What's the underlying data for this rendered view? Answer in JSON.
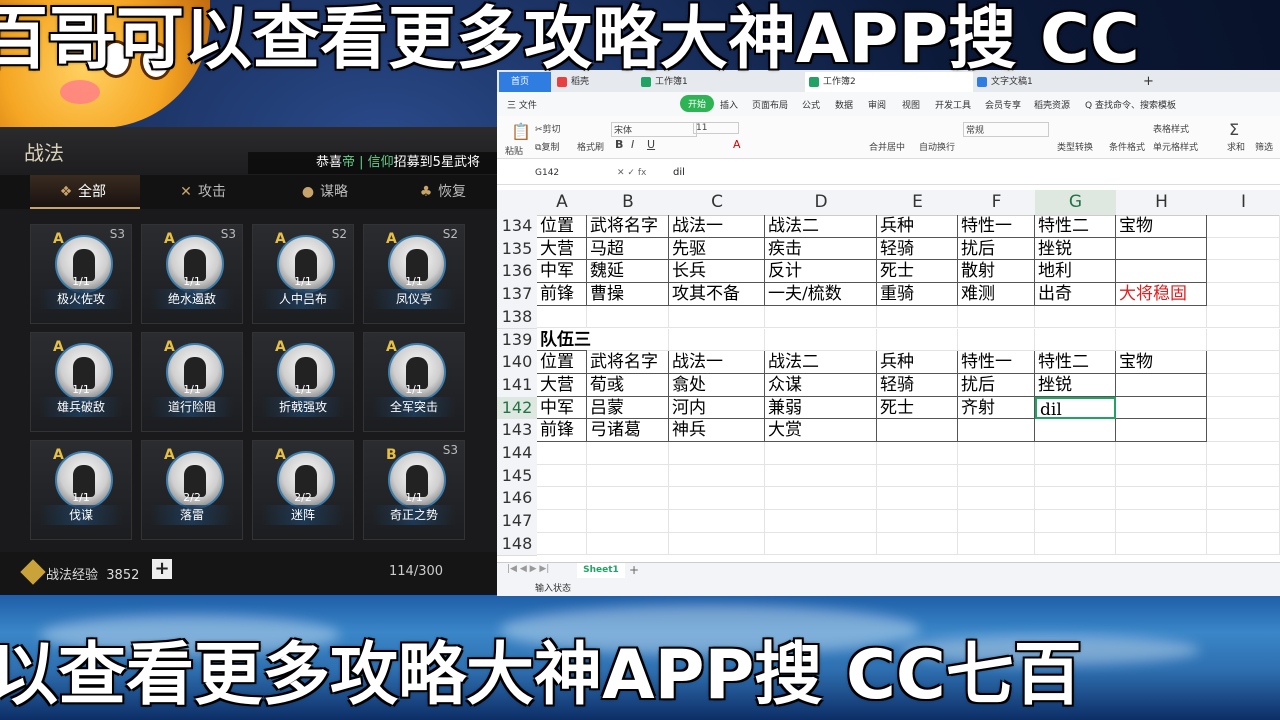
{
  "overlay": {
    "top_text": "百哥可以查看更多攻略大神APP搜 CC",
    "bottom_text": "以查看更多攻略大神APP搜 CC七百"
  },
  "game": {
    "title": "战法",
    "marquee_prefix": "恭喜",
    "marquee_name": "帝 | 信仰",
    "marquee_suffix": "招募到5星武将",
    "tabs": [
      {
        "label": "全部",
        "icon": "flag-icon"
      },
      {
        "label": "攻击",
        "icon": "swords-icon"
      },
      {
        "label": "谋略",
        "icon": "scroll-icon"
      },
      {
        "label": "恢复",
        "icon": "potion-icon"
      }
    ],
    "cards": [
      {
        "grade": "A",
        "tier": "S3",
        "level": "1/1",
        "name": "极火佐攻"
      },
      {
        "grade": "A",
        "tier": "S3",
        "level": "1/1",
        "name": "绝水遏敌"
      },
      {
        "grade": "A",
        "tier": "S2",
        "level": "1/1",
        "name": "人中吕布"
      },
      {
        "grade": "A",
        "tier": "S2",
        "level": "1/1",
        "name": "凤仪亭"
      },
      {
        "grade": "A",
        "tier": "",
        "level": "1/1",
        "name": "雄兵破敌"
      },
      {
        "grade": "A",
        "tier": "",
        "level": "1/1",
        "name": "道行险阻"
      },
      {
        "grade": "A",
        "tier": "",
        "level": "1/1",
        "name": "折戟强攻"
      },
      {
        "grade": "A",
        "tier": "",
        "level": "1/1",
        "name": "全军突击"
      },
      {
        "grade": "A",
        "tier": "",
        "level": "1/1",
        "name": "伐谋"
      },
      {
        "grade": "A",
        "tier": "",
        "level": "2/2",
        "name": "落雷"
      },
      {
        "grade": "A",
        "tier": "",
        "level": "2/2",
        "name": "迷阵"
      },
      {
        "grade": "B",
        "tier": "S3",
        "level": "1/1",
        "name": "奇正之势"
      }
    ],
    "exp_label": "战法经验",
    "exp_value": "3852",
    "plus": "+",
    "count": "114/300"
  },
  "wps": {
    "tabs": {
      "home": "首页",
      "t1": "稻壳",
      "t2": "工作簿1",
      "t3": "工作簿2",
      "t4": "文字文稿1",
      "add": "+"
    },
    "menus": [
      "三 文件",
      "开始",
      "插入",
      "页面布局",
      "公式",
      "数据",
      "审阅",
      "视图",
      "开发工具",
      "会员专享",
      "稻壳资源",
      "Q 查找命令、搜索模板"
    ],
    "ribbon": {
      "cut": "剪切",
      "copy": "复制",
      "painter": "格式刷",
      "paste": "粘贴",
      "font": "宋体",
      "size": "11",
      "merge": "合并居中",
      "wrap": "自动换行",
      "number_format": "常规",
      "convert": "类型转换",
      "cond": "条件格式",
      "table_style": "表格样式",
      "cell_style": "单元格样式",
      "sum": "求和",
      "filter": "筛选"
    },
    "namebox": "G142",
    "fx": "fx",
    "formula": "dil",
    "columns": [
      "A",
      "B",
      "C",
      "D",
      "E",
      "F",
      "G",
      "H",
      "I"
    ],
    "rows": [
      {
        "num": "134",
        "cells": [
          "位置",
          "武将名字",
          "战法一",
          "战法二",
          "兵种",
          "特性一",
          "特性二",
          "宝物"
        ]
      },
      {
        "num": "135",
        "cells": [
          "大营",
          "马超",
          "先驱",
          "疾击",
          "轻骑",
          "扰后",
          "挫锐",
          ""
        ]
      },
      {
        "num": "136",
        "cells": [
          "中军",
          "魏延",
          "长兵",
          "反计",
          "死士",
          "散射",
          "地利",
          ""
        ]
      },
      {
        "num": "137",
        "cells": [
          "前锋",
          "曹操",
          "攻其不备",
          "一夫/梳数",
          "重骑",
          "难测",
          "出奇",
          "大将稳固"
        ]
      },
      {
        "num": "138",
        "cells": [
          "",
          "",
          "",
          "",
          "",
          "",
          "",
          ""
        ]
      },
      {
        "num": "139",
        "cells": [
          "队伍三",
          "",
          "",
          "",
          "",
          "",
          "",
          ""
        ]
      },
      {
        "num": "140",
        "cells": [
          "位置",
          "武将名字",
          "战法一",
          "战法二",
          "兵种",
          "特性一",
          "特性二",
          "宝物"
        ]
      },
      {
        "num": "141",
        "cells": [
          "大营",
          "荀彧",
          "翕处",
          "众谋",
          "轻骑",
          "扰后",
          "挫锐",
          ""
        ]
      },
      {
        "num": "142",
        "cells": [
          "中军",
          "吕蒙",
          "河内",
          "兼弱",
          "死士",
          "齐射",
          "dil",
          ""
        ]
      },
      {
        "num": "143",
        "cells": [
          "前锋",
          "弓诸葛",
          "神兵",
          "大赏",
          "",
          "",
          "",
          ""
        ]
      },
      {
        "num": "144",
        "cells": [
          "",
          "",
          "",
          "",
          "",
          "",
          "",
          ""
        ]
      },
      {
        "num": "145",
        "cells": [
          "",
          "",
          "",
          "",
          "",
          "",
          "",
          ""
        ]
      },
      {
        "num": "146",
        "cells": [
          "",
          "",
          "",
          "",
          "",
          "",
          "",
          ""
        ]
      },
      {
        "num": "147",
        "cells": [
          "",
          "",
          "",
          "",
          "",
          "",
          "",
          ""
        ]
      },
      {
        "num": "148",
        "cells": [
          "",
          "",
          "",
          "",
          "",
          "",
          "",
          ""
        ]
      }
    ],
    "sheet_tab": "Sheet1",
    "sheet_add": "+",
    "status": "输入状态"
  }
}
